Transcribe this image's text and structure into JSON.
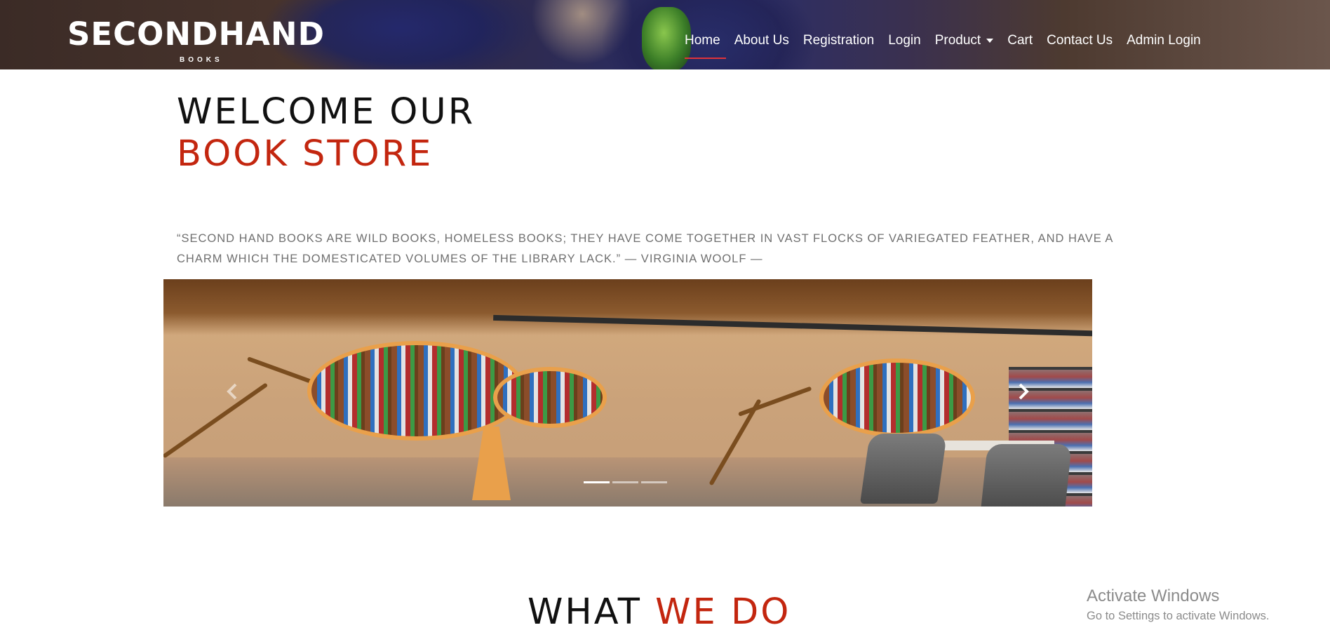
{
  "header": {
    "logo": {
      "main": "SECONDHAND",
      "sub": "BOOKS"
    },
    "nav": [
      {
        "label": "Home",
        "active": true
      },
      {
        "label": "About Us"
      },
      {
        "label": "Registration"
      },
      {
        "label": "Login"
      },
      {
        "label": "Product",
        "dropdown": true
      },
      {
        "label": "Cart"
      },
      {
        "label": "Contact Us"
      },
      {
        "label": "Admin Login"
      }
    ],
    "active_underline_color": "#e0333a"
  },
  "welcome": {
    "line1": "WELCOME OUR",
    "line2": "BOOK STORE",
    "accent_color": "#c3260f"
  },
  "quote": "“SECOND HAND BOOKS ARE WILD BOOKS, HOMELESS BOOKS; THEY HAVE COME TOGETHER IN VAST FLOCKS OF VARIEGATED FEATHER, AND HAVE A CHARM WHICH THE DOMESTICATED VOLUMES OF THE LIBRARY LACK.” — VIRGINIA WOOLF —",
  "carousel": {
    "slide_count": 3,
    "active_index": 0,
    "prev_icon": "chevron-left-icon",
    "next_icon": "chevron-right-icon"
  },
  "section": {
    "title_part1": "WHAT",
    "title_part2": "WE DO"
  },
  "watermark": {
    "title": "Activate Windows",
    "subtitle": "Go to Settings to activate Windows."
  }
}
